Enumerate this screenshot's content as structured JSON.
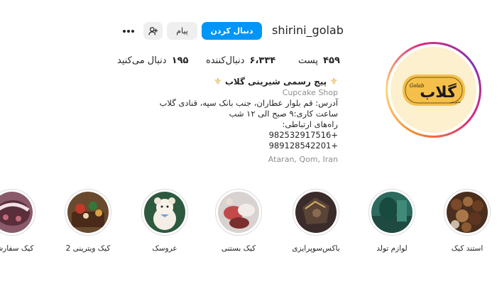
{
  "profile": {
    "username": "shirini_golab",
    "follow_label": "دنبال کردن",
    "message_label": "پیام",
    "more_icon": "more-horizontal-icon",
    "suggest_icon": "add-person-icon"
  },
  "stats": {
    "posts_count": "۴۵۹",
    "posts_label": "پست",
    "followers_count": "۶،۳۳۴",
    "followers_label": "دنبال‌کننده",
    "following_count": "۱۹۵",
    "following_label": "دنبال می‌کنید"
  },
  "bio": {
    "name": "پیج رسمی شیرینی گلاب",
    "category": "Cupcake Shop",
    "address": "آدرس: قم بلوار عطاران، جنب بانک سپه، قنادی گلاب",
    "hours": "ساعت کاری:۹ صبح الی ۱۲ شب",
    "contact_label": "راه‌های ارتباطی:",
    "phone1": "982532917516+",
    "phone2": "989128542201+",
    "location": "Ataran, Qom, Iran"
  },
  "avatar": {
    "logo_text": "گلاب",
    "logo_script": "Golab",
    "logo_small": "شیرینی"
  },
  "highlights": [
    {
      "label": "استند کیک"
    },
    {
      "label": "لوازم تولد"
    },
    {
      "label": "باکس‌سوپرایزی"
    },
    {
      "label": "کیک بستنی"
    },
    {
      "label": "عروسک"
    },
    {
      "label": "کیک ویترینی 2"
    },
    {
      "label": "کیک سفارشی"
    }
  ]
}
